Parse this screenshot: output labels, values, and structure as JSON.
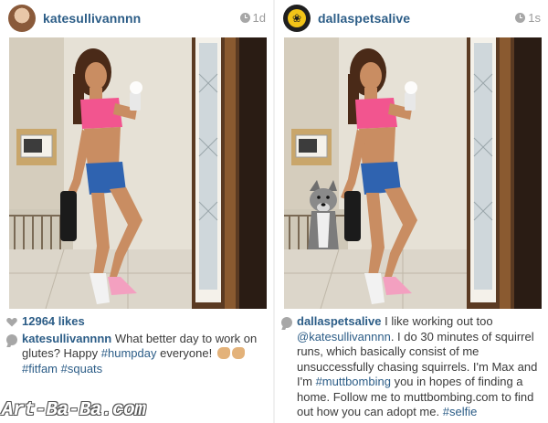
{
  "left_post": {
    "username": "katesullivannnn",
    "time": "1d",
    "likes": "12964 likes",
    "caption_user": "katesullivannnn",
    "caption_part1": "What better day to work on glutes? Happy",
    "caption_tag1": "#humpday",
    "caption_part2": "everyone!",
    "caption_tag2": "#fitfam",
    "caption_tag3": "#squats",
    "avatar_icon": "profile-photo",
    "time_icon": "clock-icon"
  },
  "right_post": {
    "username": "dallaspetsalive",
    "time": "1s",
    "caption_user": "dallaspetsalive",
    "caption_part1": "I like working out too",
    "caption_mention": "@katesullivannnn",
    "caption_part2": ". I do 30 minutes of squirrel runs, which basically consist of me unsuccessfully chasing squirrels. I'm Max and I'm",
    "caption_tag1": "#muttbombing",
    "caption_part3": "you in hopes of finding a home. Follow me to muttbombing.com to find out how you can adopt me.",
    "caption_tag2": "#selfie",
    "avatar_icon": "paw-icon",
    "time_icon": "clock-icon"
  },
  "watermark": "Art-Ba-Ba.com",
  "colors": {
    "username": "#2c5d87",
    "meta_gray": "#9a9a9a",
    "sports_bra": "#f2558f",
    "shorts": "#2f63b0",
    "dpa_yellow": "#f2c418"
  }
}
